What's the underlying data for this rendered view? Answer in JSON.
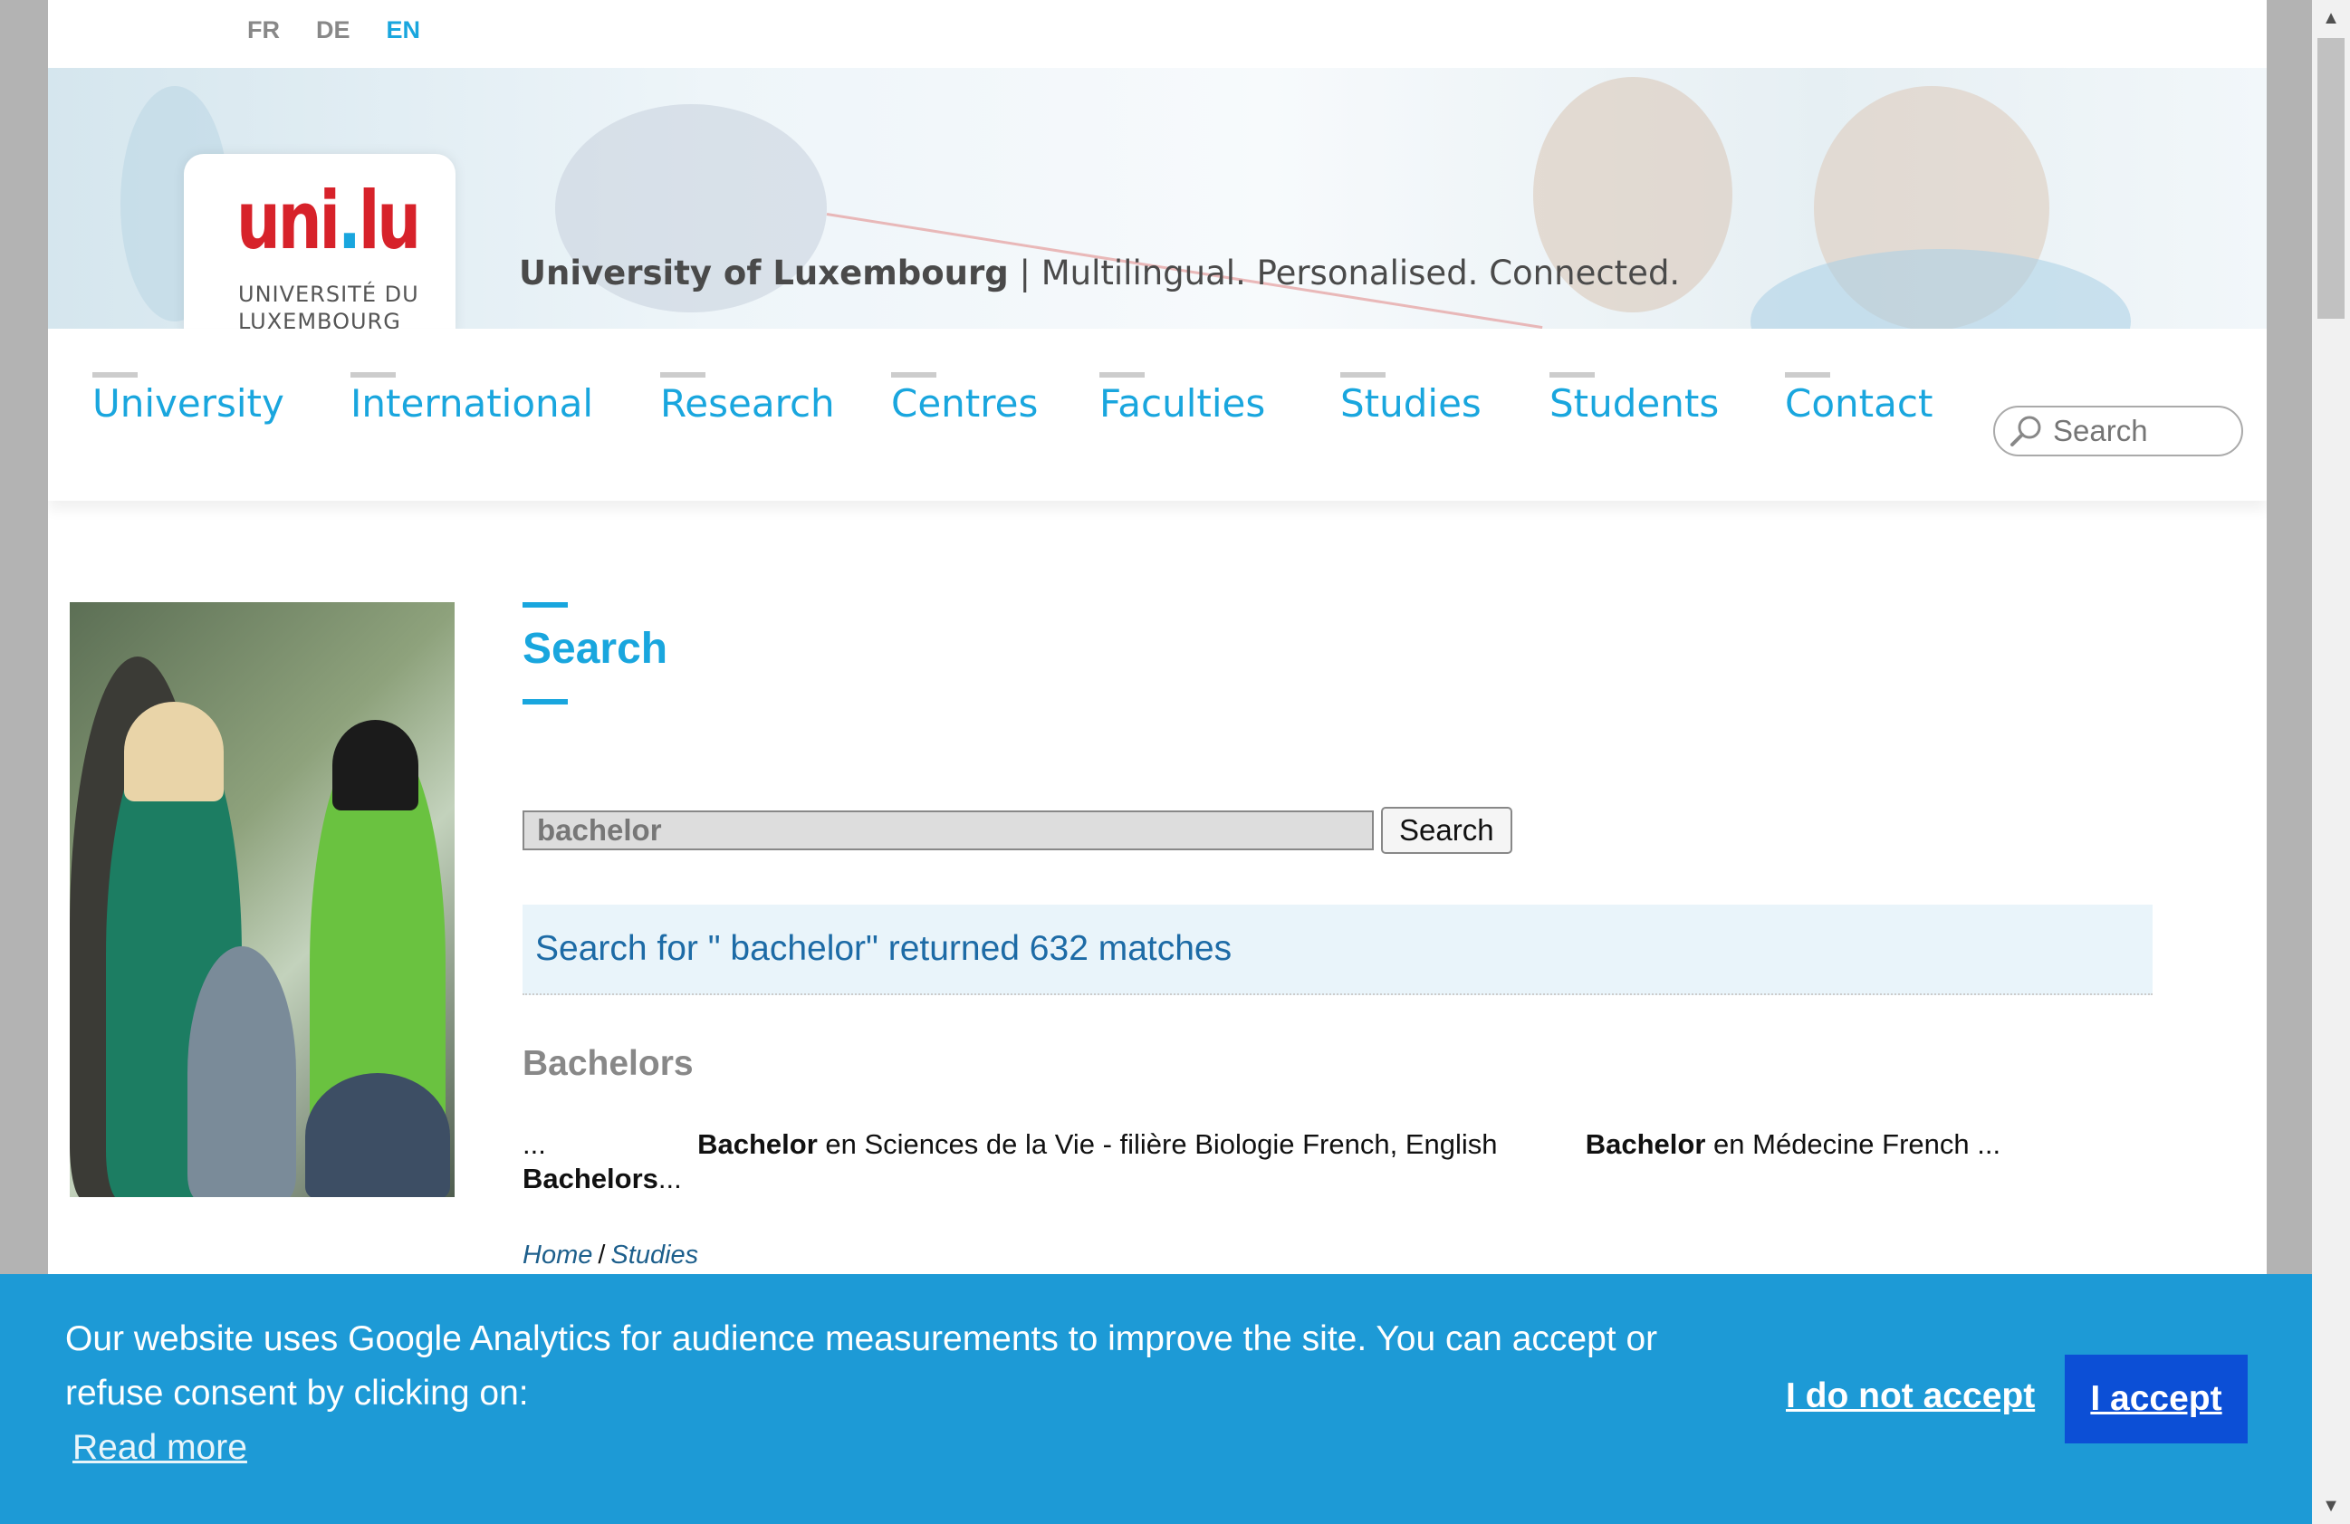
{
  "languages": [
    {
      "label": "FR",
      "active": false
    },
    {
      "label": "DE",
      "active": false
    },
    {
      "label": "EN",
      "active": true
    }
  ],
  "banner": {
    "logo_mark_main": "uni",
    "logo_mark_dot": ".",
    "logo_mark_end": "lu",
    "logo_line1": "UNIVERSITÉ DU",
    "logo_line2": "LUXEMBOURG",
    "tagline_bold": "University of Luxembourg",
    "tagline_rest": " | Multilingual. Personalised. Connected."
  },
  "nav": {
    "items": [
      "University",
      "International",
      "Research",
      "Centres",
      "Faculties",
      "Studies",
      "Students",
      "Contact"
    ],
    "search_placeholder": "Search"
  },
  "main": {
    "title": "Search",
    "search_value": "bachelor",
    "search_button": "Search",
    "result_summary": "Search for \" bachelor\" returned 632 matches",
    "section_heading": "Bachelors",
    "snippet": {
      "lead": "...",
      "bold1": "Bachelor",
      "text1": " en Sciences de la Vie - filière Biologie   French, English",
      "bold2": "Bachelor",
      "text2": " en Médecine   French ...",
      "bold3": "Bachelors",
      "text3": "..."
    },
    "breadcrumb": {
      "home": "Home",
      "separator": "/",
      "current": "Studies"
    }
  },
  "cookie": {
    "message": "Our website uses Google Analytics for audience measurements to improve the site. You can accept or refuse consent by clicking on:",
    "read_more": "Read more",
    "decline": "I do not accept",
    "accept": "I accept"
  },
  "colors": {
    "brand_blue": "#19a6de",
    "brand_red": "#d7222a",
    "cookie_bg": "#1d9ad6",
    "accept_bg": "#0c4fd6"
  }
}
